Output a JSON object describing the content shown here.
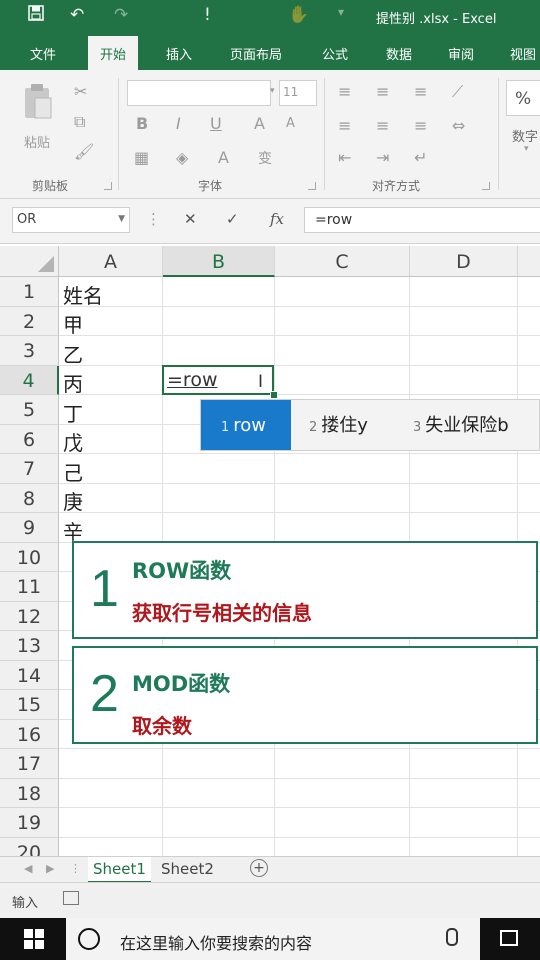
{
  "window": {
    "title": "提性别 .xlsx - Excel",
    "quick_access": [
      "save-icon",
      "undo-icon",
      "redo-icon",
      "alert-icon",
      "touch-mode-icon"
    ]
  },
  "ribbon": {
    "tabs": [
      {
        "label": "文件",
        "active": false
      },
      {
        "label": "开始",
        "active": true
      },
      {
        "label": "插入",
        "active": false
      },
      {
        "label": "页面布局",
        "active": false
      },
      {
        "label": "公式",
        "active": false
      },
      {
        "label": "数据",
        "active": false
      },
      {
        "label": "审阅",
        "active": false
      },
      {
        "label": "视图",
        "active": false
      }
    ],
    "clipboard": {
      "paste_label": "粘贴",
      "group_label": "剪贴板"
    },
    "font": {
      "size_value": "11",
      "bold": "B",
      "italic": "I",
      "underline": "U",
      "grow": "A",
      "shrink": "A",
      "font_color": "A",
      "phonetic": "变",
      "group_label": "字体"
    },
    "alignment": {
      "group_label": "对齐方式"
    },
    "number": {
      "percent": "%",
      "group_label": "数字"
    }
  },
  "formula_bar": {
    "name_box": "OR",
    "cancel": "✕",
    "enter": "✓",
    "fx": "fx",
    "content": "=row"
  },
  "grid": {
    "columns": [
      "A",
      "B",
      "C",
      "D"
    ],
    "selected_column": "B",
    "rows": [
      "1",
      "2",
      "3",
      "4",
      "5",
      "6",
      "7",
      "8",
      "9",
      "10",
      "11",
      "12",
      "13",
      "14",
      "15",
      "16",
      "17",
      "18",
      "19",
      "20"
    ],
    "selected_row": "4",
    "column_a": [
      "姓名",
      "甲",
      "乙",
      "丙",
      "丁",
      "戊",
      "己",
      "庚",
      "辛"
    ],
    "active_cell": "B4",
    "active_cell_text": "=row"
  },
  "ime": {
    "candidates": [
      {
        "num": "1",
        "text": "row",
        "selected": true
      },
      {
        "num": "2",
        "text": "搂住y",
        "selected": false
      },
      {
        "num": "3",
        "text": "失业保险b",
        "selected": false
      }
    ]
  },
  "overlays": [
    {
      "number": "1",
      "heading": "ROW函数",
      "subtitle": "获取行号相关的信息"
    },
    {
      "number": "2",
      "heading": "MOD函数",
      "subtitle": "取余数"
    }
  ],
  "sheets": {
    "tabs": [
      {
        "label": "Sheet1",
        "active": true
      },
      {
        "label": "Sheet2",
        "active": false
      }
    ],
    "add": "+"
  },
  "status": {
    "mode": "输入"
  },
  "taskbar": {
    "search_placeholder": "在这里输入你要搜索的内容"
  },
  "colors": {
    "excel_green": "#217346",
    "overlay_green": "#1f7a59",
    "overlay_red": "#b0161c",
    "ime_highlight": "#1979ca"
  }
}
